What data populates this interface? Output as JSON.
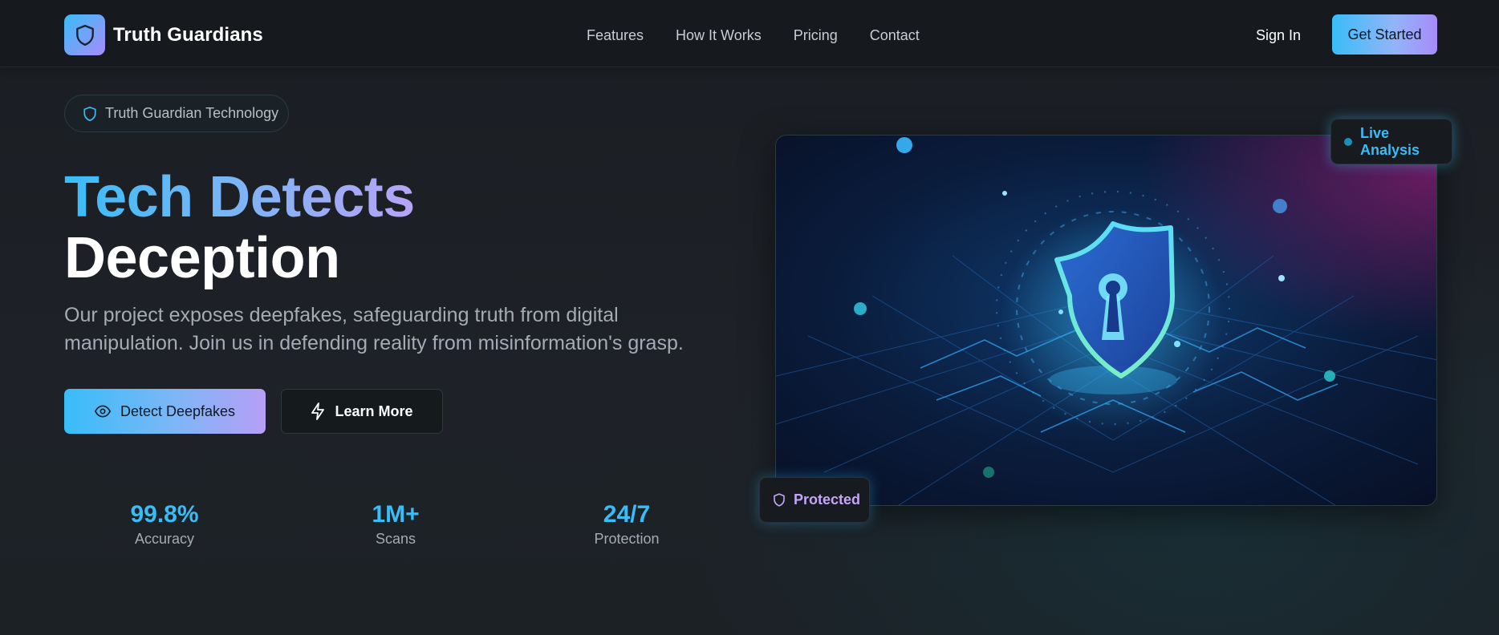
{
  "nav": {
    "brand": "Truth Guardians",
    "links": [
      "Features",
      "How It Works",
      "Pricing",
      "Contact"
    ],
    "sign_in": "Sign In",
    "get_started": "Get Started",
    "brand_icon": "shield-icon"
  },
  "hero": {
    "tag": "Truth Guardian Technology",
    "headline_1": "Tech Detects",
    "headline_2": "Deception",
    "subtitle": "Our project exposes deepfakes, safeguarding truth from digital manipulation. Join us in defending reality from misinformation's grasp.",
    "detect_button": "Detect Deepfakes",
    "learn_button": "Learn More"
  },
  "stats": [
    {
      "value": "99.8%",
      "label": "Accuracy"
    },
    {
      "value": "1M+",
      "label": "Scans"
    },
    {
      "value": "24/7",
      "label": "Protection"
    }
  ],
  "image_badges": {
    "live": "Live Analysis",
    "protected": "Protected"
  },
  "colors": {
    "accent_cyan": "#38bdf8",
    "accent_purple": "#a78bfa",
    "background": "#1c2026"
  }
}
